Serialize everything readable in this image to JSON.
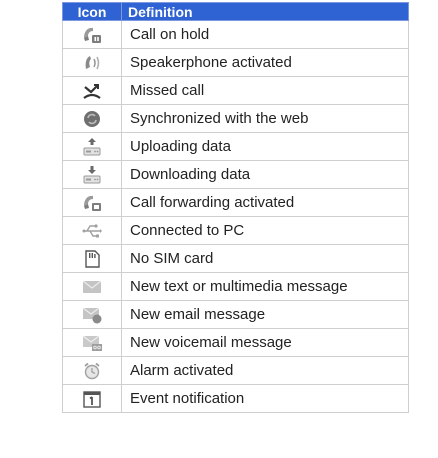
{
  "header": {
    "icon": "Icon",
    "definition": "Definition"
  },
  "rows": [
    {
      "icon": "call-hold-icon",
      "definition": "Call on hold"
    },
    {
      "icon": "speakerphone-icon",
      "definition": "Speakerphone activated"
    },
    {
      "icon": "missed-call-icon",
      "definition": "Missed call"
    },
    {
      "icon": "sync-web-icon",
      "definition": "Synchronized with the web"
    },
    {
      "icon": "upload-data-icon",
      "definition": "Uploading data"
    },
    {
      "icon": "download-data-icon",
      "definition": "Downloading data"
    },
    {
      "icon": "call-forward-icon",
      "definition": "Call forwarding activated"
    },
    {
      "icon": "usb-icon",
      "definition": "Connected to PC"
    },
    {
      "icon": "no-sim-icon",
      "definition": "No SIM card"
    },
    {
      "icon": "message-icon",
      "definition": "New text or multimedia message"
    },
    {
      "icon": "email-icon",
      "definition": "New email message"
    },
    {
      "icon": "voicemail-icon",
      "definition": "New voicemail message"
    },
    {
      "icon": "alarm-icon",
      "definition": "Alarm activated"
    },
    {
      "icon": "event-icon",
      "definition": "Event notification"
    }
  ],
  "colors": {
    "header_bg": "#2f62d3",
    "header_text": "#ffffff",
    "icon_gray": "#9a9a9a"
  }
}
